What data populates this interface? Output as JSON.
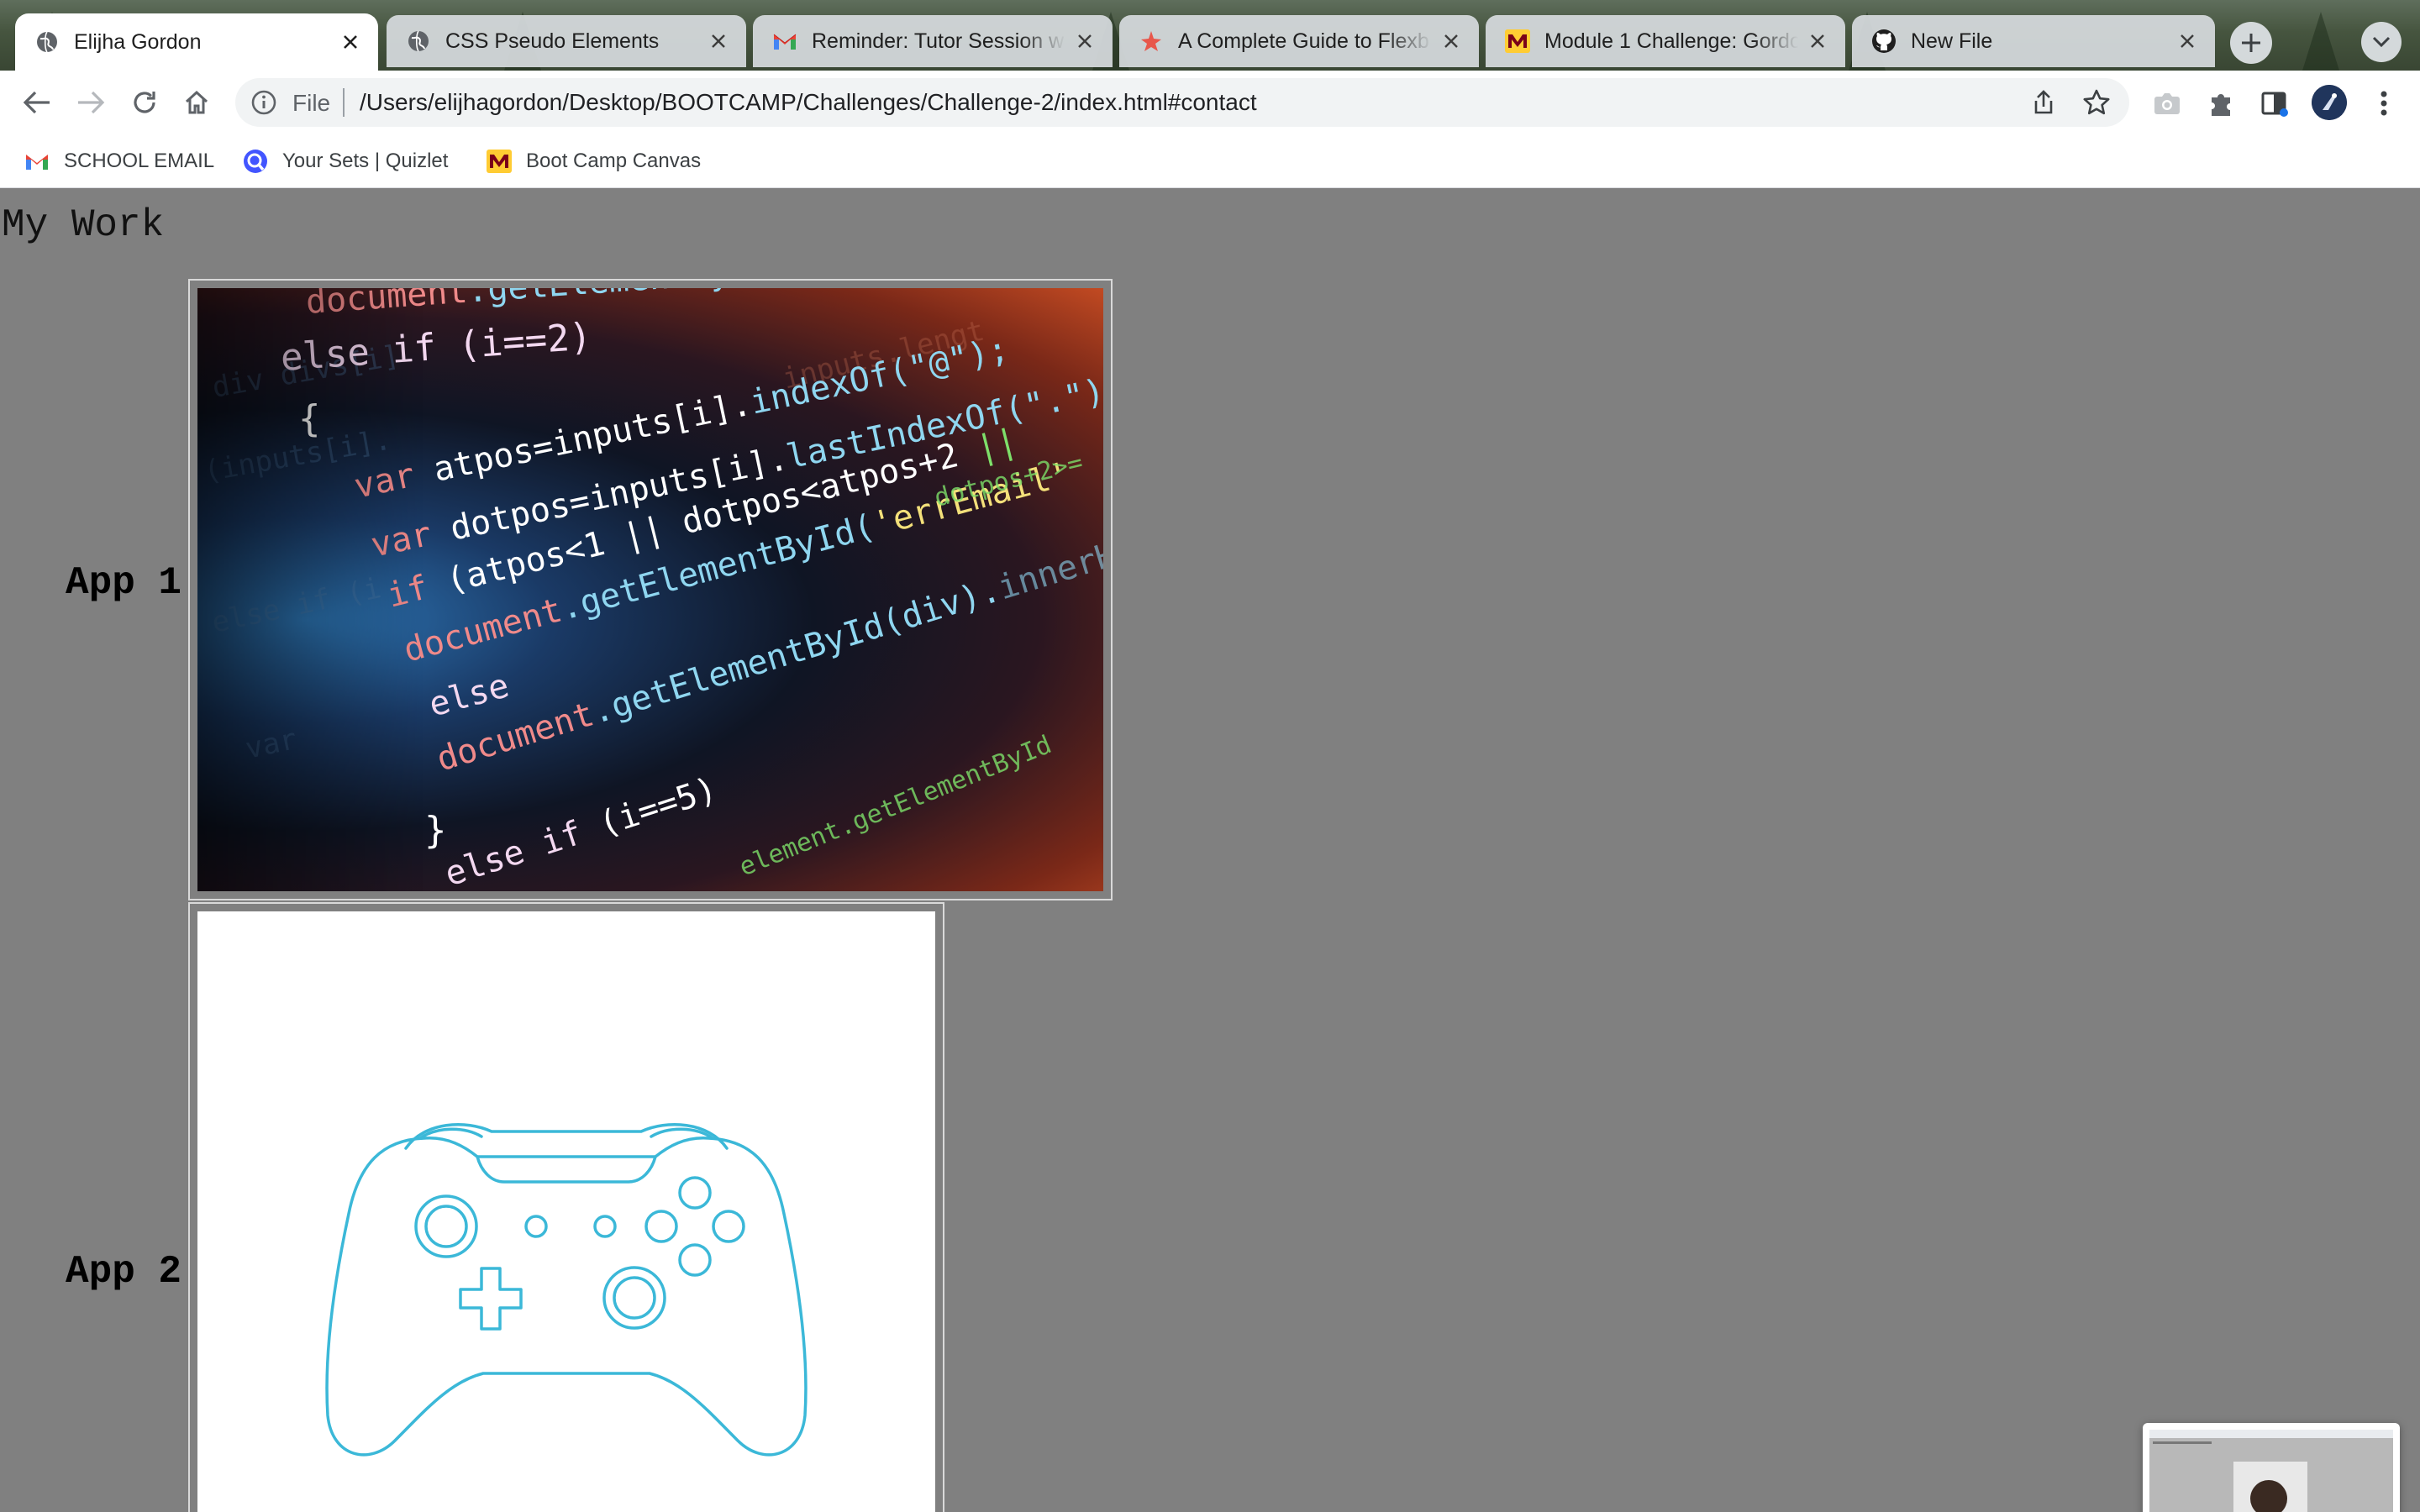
{
  "browser": {
    "tabs": [
      {
        "title": "Elijha Gordon",
        "favicon": "globe-icon",
        "active": true
      },
      {
        "title": "CSS Pseudo Elements",
        "favicon": "globe-icon",
        "active": false
      },
      {
        "title": "Reminder: Tutor Session w",
        "favicon": "gmail-icon",
        "active": false
      },
      {
        "title": "A Complete Guide to Flexb",
        "favicon": "css-tricks-icon",
        "active": false
      },
      {
        "title": "Module 1 Challenge: Gordo",
        "favicon": "canvas-umn-icon",
        "active": false
      },
      {
        "title": "New File",
        "favicon": "github-icon",
        "active": false
      }
    ],
    "address_bar": {
      "scheme_label": "File",
      "url": "/Users/elijhagordon/Desktop/BOOTCAMP/Challenges/Challenge-2/index.html#contact"
    },
    "bookmarks": [
      {
        "label": "SCHOOL EMAIL",
        "icon": "gmail-icon"
      },
      {
        "label": "Your Sets | Quizlet",
        "icon": "quizlet-icon"
      },
      {
        "label": "Boot Camp Canvas",
        "icon": "canvas-umn-icon"
      }
    ],
    "colors": {
      "accent": "#1a73e8",
      "gmail_red": "#ea4335",
      "umn_gold": "#ffcc33",
      "umn_maroon": "#7a0019"
    }
  },
  "page": {
    "heading": "My Work",
    "apps": [
      {
        "label": "App 1",
        "image": "code-screenshot"
      },
      {
        "label": "App 2",
        "image": "game-controller"
      }
    ],
    "code_image_lines": [
      "document.getElementById(div).",
      "else if (i==2)",
      "{",
      "var atpos=inputs[i].indexOf(\"@\");",
      "var dotpos=inputs[i].lastIndexOf(\".\");",
      "if (atpos<1 || dotpos<atpos+2",
      "document.getElementById('errEmail'",
      "else",
      "document.getElementById(div).",
      "}",
      "else if (i==5)"
    ]
  }
}
